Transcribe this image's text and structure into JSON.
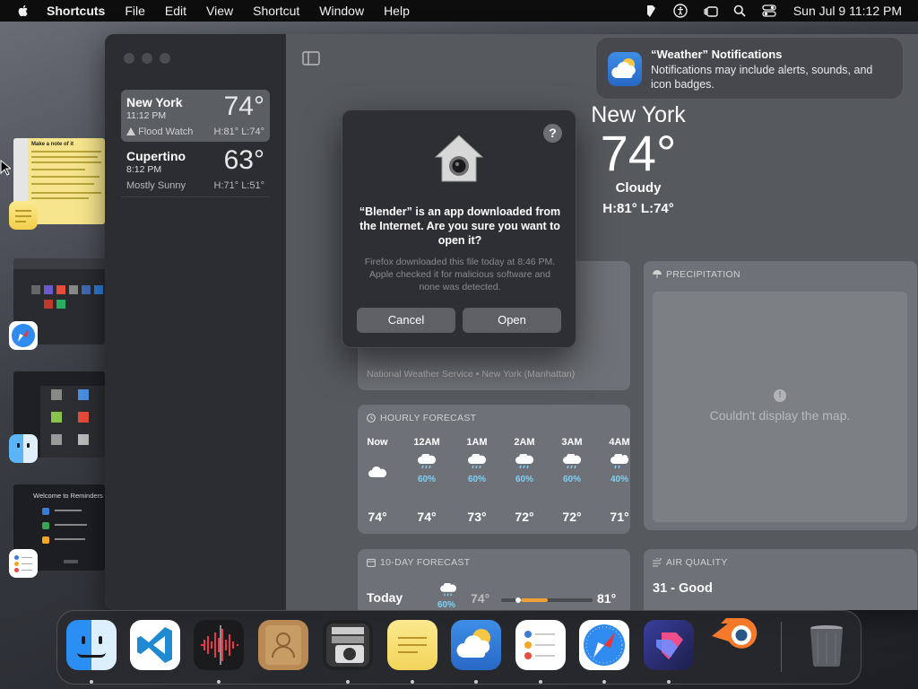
{
  "menubar": {
    "app": "Shortcuts",
    "items": [
      "File",
      "Edit",
      "View",
      "Shortcut",
      "Window",
      "Help"
    ],
    "clock": "Sun Jul 9  11:12 PM"
  },
  "sidebar": {
    "cities": [
      {
        "name": "New York",
        "time": "11:12 PM",
        "temp": "74°",
        "condition": "Flood Watch",
        "hilo": "H:81°  L:74°"
      },
      {
        "name": "Cupertino",
        "time": "8:12 PM",
        "temp": "63°",
        "condition": "Mostly Sunny",
        "hilo": "H:71°  L:51°"
      }
    ]
  },
  "hero": {
    "city": "New York",
    "temp": "74°",
    "condition": "Cloudy",
    "hilo": "H:81°  L:74°"
  },
  "cards": {
    "alert_source": "National Weather Service • New York (Manhattan)",
    "precip_title": "PRECIPITATION",
    "precip_msg": "Couldn't display the map.",
    "hourly_title": "HOURLY FORECAST",
    "hourly": [
      {
        "hour": "Now",
        "pct": "",
        "temp": "74°"
      },
      {
        "hour": "12AM",
        "pct": "60%",
        "temp": "74°"
      },
      {
        "hour": "1AM",
        "pct": "60%",
        "temp": "73°"
      },
      {
        "hour": "2AM",
        "pct": "60%",
        "temp": "72°"
      },
      {
        "hour": "3AM",
        "pct": "60%",
        "temp": "72°"
      },
      {
        "hour": "4AM",
        "pct": "40%",
        "temp": "71°"
      }
    ],
    "tenday_title": "10-DAY FORECAST",
    "tenday_day": "Today",
    "tenday_pct": "60%",
    "tenday_low": "74°",
    "tenday_high": "81°",
    "air_title": "AIR QUALITY",
    "air_value": "31 - Good"
  },
  "notification": {
    "title": "“Weather” Notifications",
    "body": "Notifications may include alerts, sounds, and icon badges."
  },
  "dialog": {
    "title": "“Blender” is an app downloaded from the Internet. Are you sure you want to open it?",
    "message": "Firefox downloaded this file today at 8:46 PM. Apple checked it for malicious software and none was detected.",
    "help": "?",
    "cancel": "Cancel",
    "open": "Open"
  },
  "stage_thumbs": {
    "notes_title": "Make a note of it",
    "reminders_title": "Welcome to Reminders"
  },
  "dock": [
    "Finder",
    "Visual Studio Code",
    "Voice Memos",
    "Contacts",
    "Image Capture",
    "Notes",
    "Weather",
    "Reminders",
    "Safari",
    "Shortcuts",
    "Blender",
    "Trash"
  ]
}
